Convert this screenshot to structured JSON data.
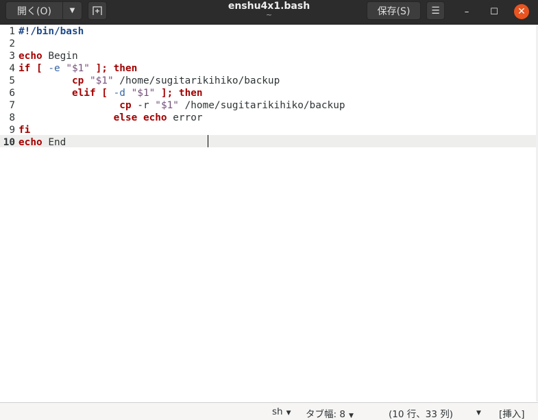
{
  "window": {
    "title": "enshu4x1.bash",
    "subtitle": "~"
  },
  "toolbar": {
    "open_label": "開く(O)",
    "save_label": "保存(S)",
    "open_dropdown_icon": "triangle-down",
    "new_tab_icon": "new-tab",
    "menu_icon": "hamburger"
  },
  "window_controls": {
    "minimize": "–",
    "maximize": "☐",
    "close": "✕"
  },
  "editor": {
    "current_line": 10,
    "lines": [
      {
        "n": "1",
        "tokens": [
          {
            "t": "#!/bin/bash",
            "c": "sh"
          }
        ]
      },
      {
        "n": "2",
        "tokens": []
      },
      {
        "n": "3",
        "tokens": [
          {
            "t": "echo",
            "c": "kw"
          },
          {
            "t": " Begin",
            "c": "tx"
          }
        ]
      },
      {
        "n": "4",
        "tokens": [
          {
            "t": "if [",
            "c": "kw"
          },
          {
            "t": " -e ",
            "c": "op"
          },
          {
            "t": "\"$1\"",
            "c": "st"
          },
          {
            "t": " ]; then",
            "c": "kw"
          }
        ]
      },
      {
        "n": "5",
        "tokens": [
          {
            "t": "         ",
            "c": "tx"
          },
          {
            "t": "cp",
            "c": "kw"
          },
          {
            "t": " ",
            "c": "tx"
          },
          {
            "t": "\"$1\"",
            "c": "st"
          },
          {
            "t": " /home/sugitarikihiko/backup",
            "c": "tx"
          }
        ]
      },
      {
        "n": "6",
        "tokens": [
          {
            "t": "         ",
            "c": "tx"
          },
          {
            "t": "elif [",
            "c": "kw"
          },
          {
            "t": " -d ",
            "c": "op"
          },
          {
            "t": "\"$1\"",
            "c": "st"
          },
          {
            "t": " ]; then",
            "c": "kw"
          }
        ]
      },
      {
        "n": "7",
        "tokens": [
          {
            "t": "                 ",
            "c": "tx"
          },
          {
            "t": "cp",
            "c": "kw"
          },
          {
            "t": " -r ",
            "c": "tx"
          },
          {
            "t": "\"$1\"",
            "c": "st"
          },
          {
            "t": " /home/sugitarikihiko/backup",
            "c": "tx"
          }
        ]
      },
      {
        "n": "8",
        "tokens": [
          {
            "t": "                ",
            "c": "tx"
          },
          {
            "t": "else echo",
            "c": "kw"
          },
          {
            "t": " error",
            "c": "tx"
          }
        ]
      },
      {
        "n": "9",
        "tokens": [
          {
            "t": "fi",
            "c": "kw"
          }
        ]
      },
      {
        "n": "10",
        "tokens": [
          {
            "t": "echo",
            "c": "kw"
          },
          {
            "t": " End",
            "c": "tx"
          }
        ]
      }
    ]
  },
  "statusbar": {
    "language": "sh",
    "tab_width": "タブ幅: 8",
    "position": "(10 行、33 列)",
    "mode": "[挿入]"
  },
  "colors": {
    "keyword": "#a40000",
    "shebang": "#204a87",
    "option": "#3465a4",
    "string": "#75507b",
    "close_button": "#e95420"
  }
}
